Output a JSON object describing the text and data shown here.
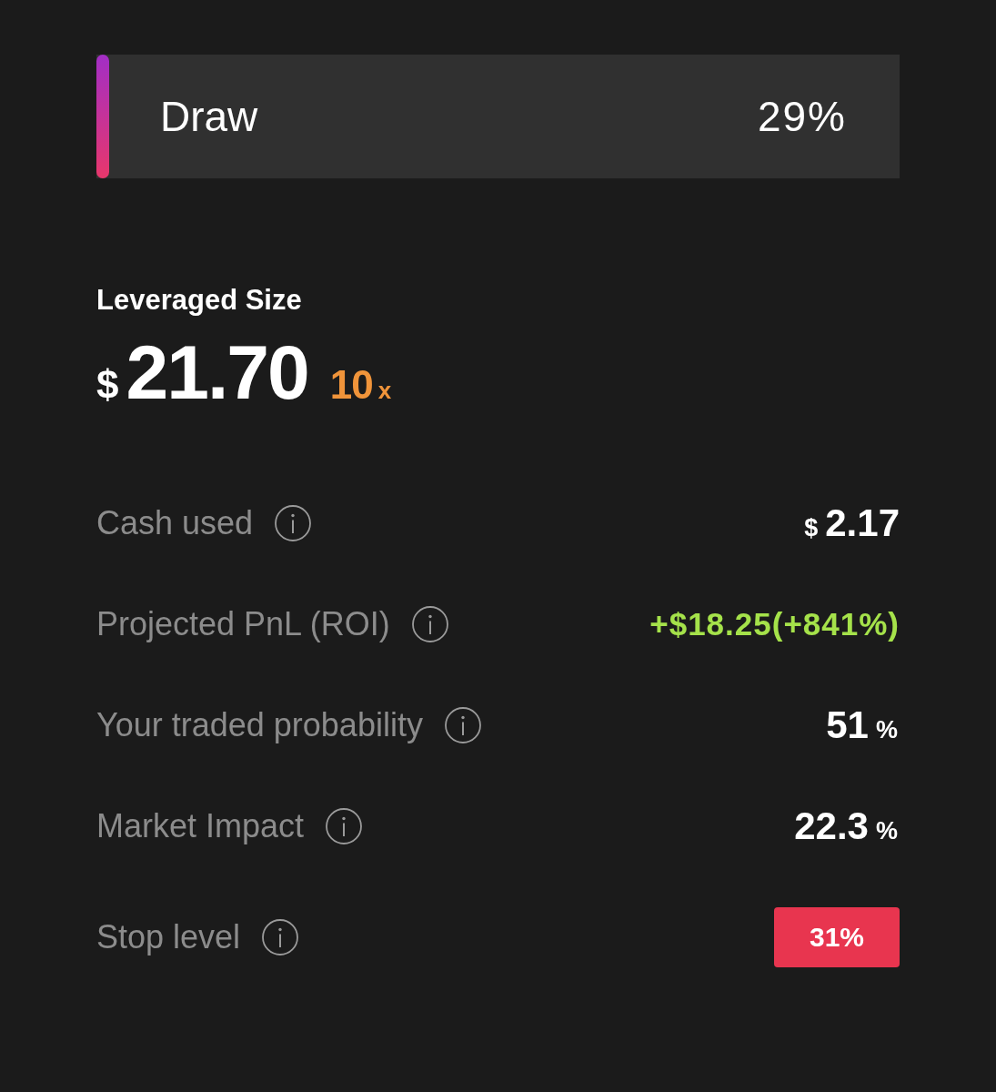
{
  "outcome": {
    "label": "Draw",
    "probability": "29%"
  },
  "leveraged_size": {
    "title": "Leveraged Size",
    "currency": "$",
    "amount": "21.70",
    "multiplier": "10",
    "multiplier_unit": "x"
  },
  "details": [
    {
      "kind": "amount",
      "label": "Cash used",
      "prefix": "$",
      "value": "2.17"
    },
    {
      "kind": "pnl",
      "label": "Projected PnL (ROI)",
      "value": "+$18.25(+841%)"
    },
    {
      "kind": "percent",
      "label": "Your traded probability",
      "value": "51",
      "suffix": "%"
    },
    {
      "kind": "percent",
      "label": "Market Impact",
      "value": "22.3",
      "suffix": "%"
    },
    {
      "kind": "badge",
      "label": "Stop level",
      "value": "31%"
    }
  ]
}
